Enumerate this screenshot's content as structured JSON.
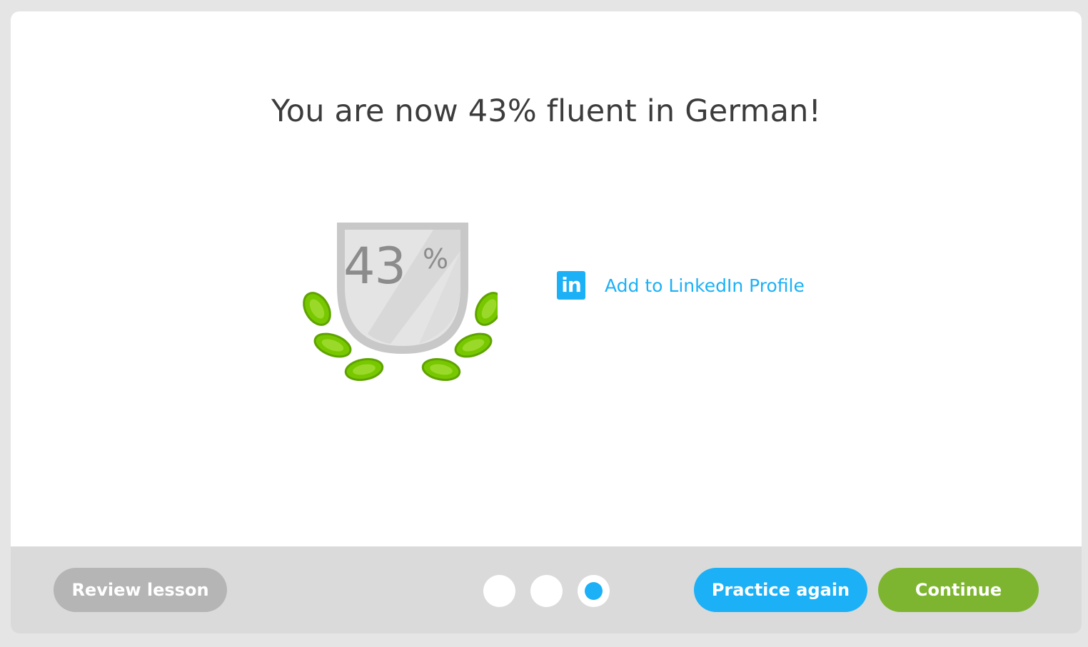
{
  "header": {
    "title": "You are now 43% fluent in German!"
  },
  "badge": {
    "value": "43",
    "unit": "%",
    "fluency_percent": 43
  },
  "share": {
    "linkedin_icon_text": "in",
    "linkedin_label": "Add to LinkedIn Profile"
  },
  "footer": {
    "review_label": "Review lesson",
    "practice_label": "Practice again",
    "continue_label": "Continue",
    "progress_dots": {
      "count": 3,
      "active_index": 2
    }
  },
  "colors": {
    "accent_blue": "#1cb0f6",
    "accent_green": "#7eb530",
    "leaf_green": "#78c800",
    "disabled_gray": "#b5b5b5"
  }
}
